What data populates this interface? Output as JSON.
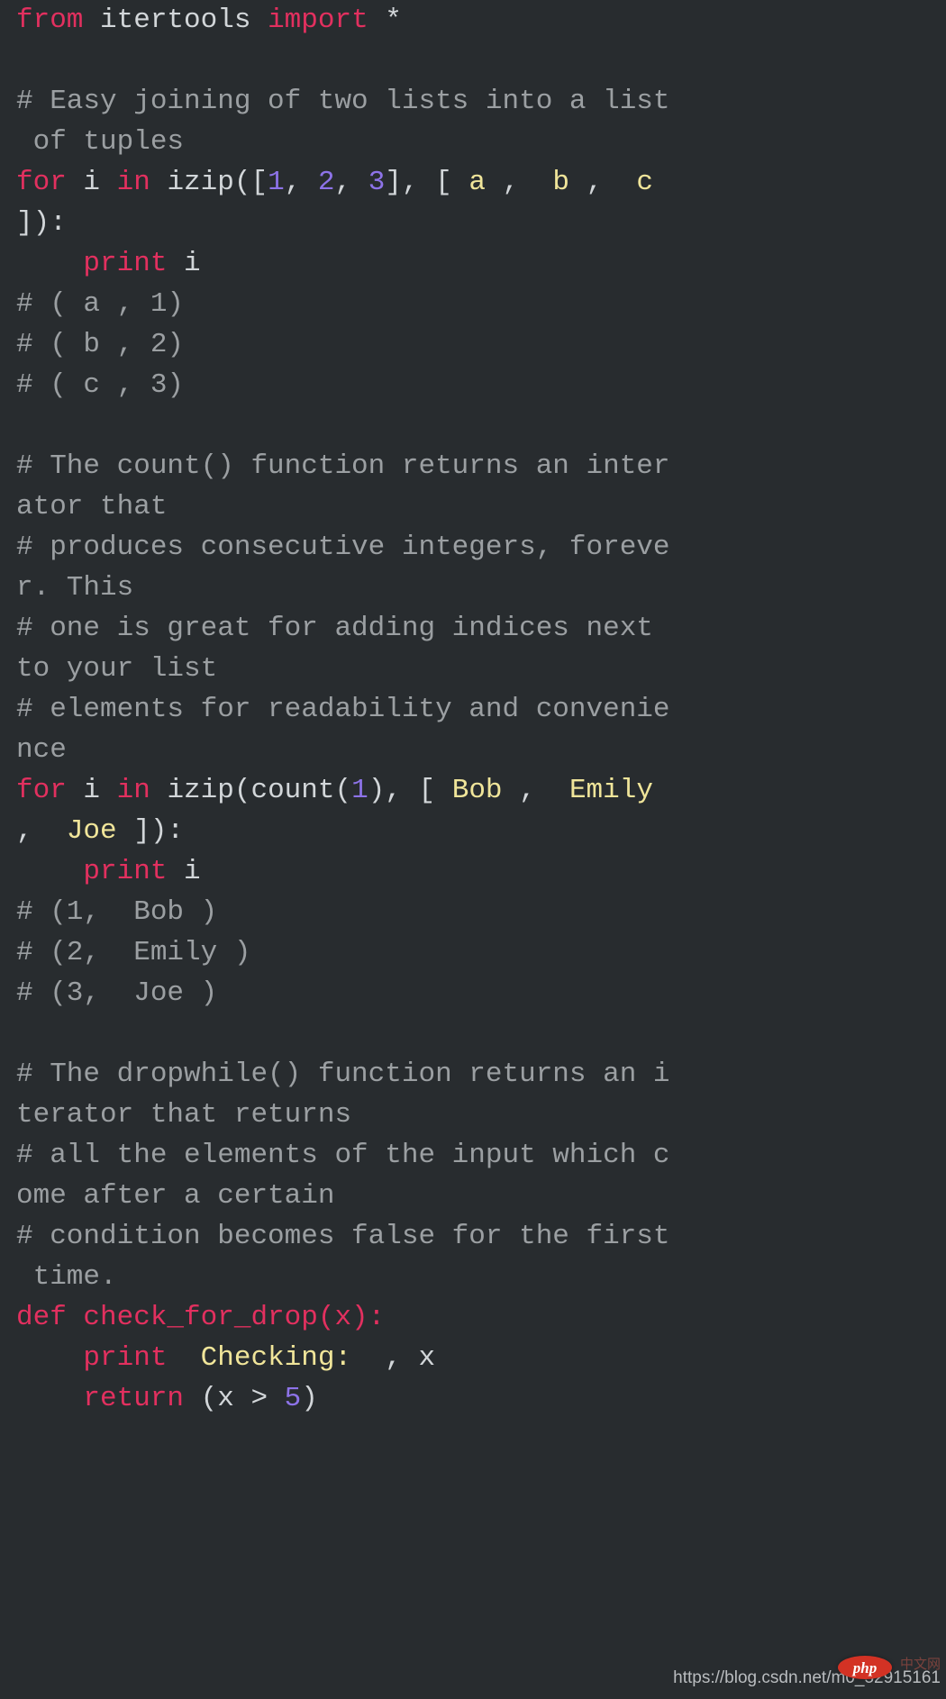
{
  "editor": {
    "language": "python",
    "background_color": "#282c2f",
    "default_text_color": "#d2d6d9",
    "theme_colors": {
      "keyword": "#e2305f",
      "number": "#8d73e8",
      "string": "#f0e59a",
      "comment": "#9b9fa2",
      "plain": "#d2d6d9"
    }
  },
  "lines": [
    {
      "id": "l1",
      "tokens": [
        {
          "t": "from",
          "c": "kw"
        },
        {
          "t": " itertools ",
          "c": "plain"
        },
        {
          "t": "import",
          "c": "kw"
        },
        {
          "t": " *",
          "c": "plain"
        }
      ]
    },
    {
      "id": "l2",
      "tokens": [
        {
          "t": "",
          "c": "plain"
        }
      ]
    },
    {
      "id": "l3",
      "tokens": [
        {
          "t": "# Easy joining of two lists into a list",
          "c": "com"
        }
      ]
    },
    {
      "id": "l4",
      "tokens": [
        {
          "t": " of tuples",
          "c": "com"
        }
      ]
    },
    {
      "id": "l5",
      "tokens": [
        {
          "t": "for",
          "c": "kw"
        },
        {
          "t": " i ",
          "c": "plain"
        },
        {
          "t": "in",
          "c": "kw"
        },
        {
          "t": " izip([",
          "c": "plain"
        },
        {
          "t": "1",
          "c": "num"
        },
        {
          "t": ", ",
          "c": "plain"
        },
        {
          "t": "2",
          "c": "num"
        },
        {
          "t": ", ",
          "c": "plain"
        },
        {
          "t": "3",
          "c": "num"
        },
        {
          "t": "], [ ",
          "c": "plain"
        },
        {
          "t": "a",
          "c": "str"
        },
        {
          "t": " ,  ",
          "c": "plain"
        },
        {
          "t": "b",
          "c": "str"
        },
        {
          "t": " ,  ",
          "c": "plain"
        },
        {
          "t": "c",
          "c": "str"
        }
      ]
    },
    {
      "id": "l6",
      "tokens": [
        {
          "t": "]):",
          "c": "plain"
        }
      ]
    },
    {
      "id": "l7",
      "tokens": [
        {
          "t": "    ",
          "c": "plain"
        },
        {
          "t": "print",
          "c": "kw"
        },
        {
          "t": " i",
          "c": "plain"
        }
      ]
    },
    {
      "id": "l8",
      "tokens": [
        {
          "t": "# ( a , 1)",
          "c": "com"
        }
      ]
    },
    {
      "id": "l9",
      "tokens": [
        {
          "t": "# ( b , 2)",
          "c": "com"
        }
      ]
    },
    {
      "id": "l10",
      "tokens": [
        {
          "t": "# ( c , 3)",
          "c": "com"
        }
      ]
    },
    {
      "id": "l11",
      "tokens": [
        {
          "t": "",
          "c": "plain"
        }
      ]
    },
    {
      "id": "l12",
      "tokens": [
        {
          "t": "# The count() function returns an inter",
          "c": "com"
        }
      ]
    },
    {
      "id": "l13",
      "tokens": [
        {
          "t": "ator that",
          "c": "com"
        }
      ]
    },
    {
      "id": "l14",
      "tokens": [
        {
          "t": "# produces consecutive integers, foreve",
          "c": "com"
        }
      ]
    },
    {
      "id": "l15",
      "tokens": [
        {
          "t": "r. This",
          "c": "com"
        }
      ]
    },
    {
      "id": "l16",
      "tokens": [
        {
          "t": "# one is great for adding indices next",
          "c": "com"
        }
      ]
    },
    {
      "id": "l17",
      "tokens": [
        {
          "t": "to your list",
          "c": "com"
        }
      ]
    },
    {
      "id": "l18",
      "tokens": [
        {
          "t": "# elements for readability and convenie",
          "c": "com"
        }
      ]
    },
    {
      "id": "l19",
      "tokens": [
        {
          "t": "nce",
          "c": "com"
        }
      ]
    },
    {
      "id": "l20",
      "tokens": [
        {
          "t": "for",
          "c": "kw"
        },
        {
          "t": " i ",
          "c": "plain"
        },
        {
          "t": "in",
          "c": "kw"
        },
        {
          "t": " izip(count(",
          "c": "plain"
        },
        {
          "t": "1",
          "c": "num"
        },
        {
          "t": "), [ ",
          "c": "plain"
        },
        {
          "t": "Bob",
          "c": "str"
        },
        {
          "t": " ,  ",
          "c": "plain"
        },
        {
          "t": "Emily",
          "c": "str"
        }
      ]
    },
    {
      "id": "l21",
      "tokens": [
        {
          "t": ",  ",
          "c": "plain"
        },
        {
          "t": "Joe",
          "c": "str"
        },
        {
          "t": " ]):",
          "c": "plain"
        }
      ]
    },
    {
      "id": "l22",
      "tokens": [
        {
          "t": "    ",
          "c": "plain"
        },
        {
          "t": "print",
          "c": "kw"
        },
        {
          "t": " i",
          "c": "plain"
        }
      ]
    },
    {
      "id": "l23",
      "tokens": [
        {
          "t": "# (1,  Bob )",
          "c": "com"
        }
      ]
    },
    {
      "id": "l24",
      "tokens": [
        {
          "t": "# (2,  Emily )",
          "c": "com"
        }
      ]
    },
    {
      "id": "l25",
      "tokens": [
        {
          "t": "# (3,  Joe )",
          "c": "com"
        }
      ]
    },
    {
      "id": "l26",
      "tokens": [
        {
          "t": "",
          "c": "plain"
        }
      ]
    },
    {
      "id": "l27",
      "tokens": [
        {
          "t": "# The dropwhile() function returns an i",
          "c": "com"
        }
      ]
    },
    {
      "id": "l28",
      "tokens": [
        {
          "t": "terator that returns",
          "c": "com"
        }
      ]
    },
    {
      "id": "l29",
      "tokens": [
        {
          "t": "# all the elements of the input which c",
          "c": "com"
        }
      ]
    },
    {
      "id": "l30",
      "tokens": [
        {
          "t": "ome after a certain",
          "c": "com"
        }
      ]
    },
    {
      "id": "l31",
      "tokens": [
        {
          "t": "# condition becomes false for the first",
          "c": "com"
        }
      ]
    },
    {
      "id": "l32",
      "tokens": [
        {
          "t": " time.",
          "c": "com"
        }
      ]
    },
    {
      "id": "l33",
      "tokens": [
        {
          "t": "def check_for_drop(x):",
          "c": "def"
        }
      ]
    },
    {
      "id": "l34",
      "tokens": [
        {
          "t": "    ",
          "c": "plain"
        },
        {
          "t": "print",
          "c": "kw"
        },
        {
          "t": "  ",
          "c": "plain"
        },
        {
          "t": "Checking:",
          "c": "str"
        },
        {
          "t": "  , x",
          "c": "plain"
        }
      ]
    },
    {
      "id": "l35",
      "tokens": [
        {
          "t": "    ",
          "c": "plain"
        },
        {
          "t": "return",
          "c": "kw"
        },
        {
          "t": " (x > ",
          "c": "plain"
        },
        {
          "t": "5",
          "c": "num"
        },
        {
          "t": ")",
          "c": "plain"
        }
      ]
    }
  ],
  "watermark": {
    "url_text": "https://blog.csdn.net/m0_52915161",
    "badge_label": "php",
    "badge_color": "#d33224",
    "mark_text": "中文网"
  }
}
